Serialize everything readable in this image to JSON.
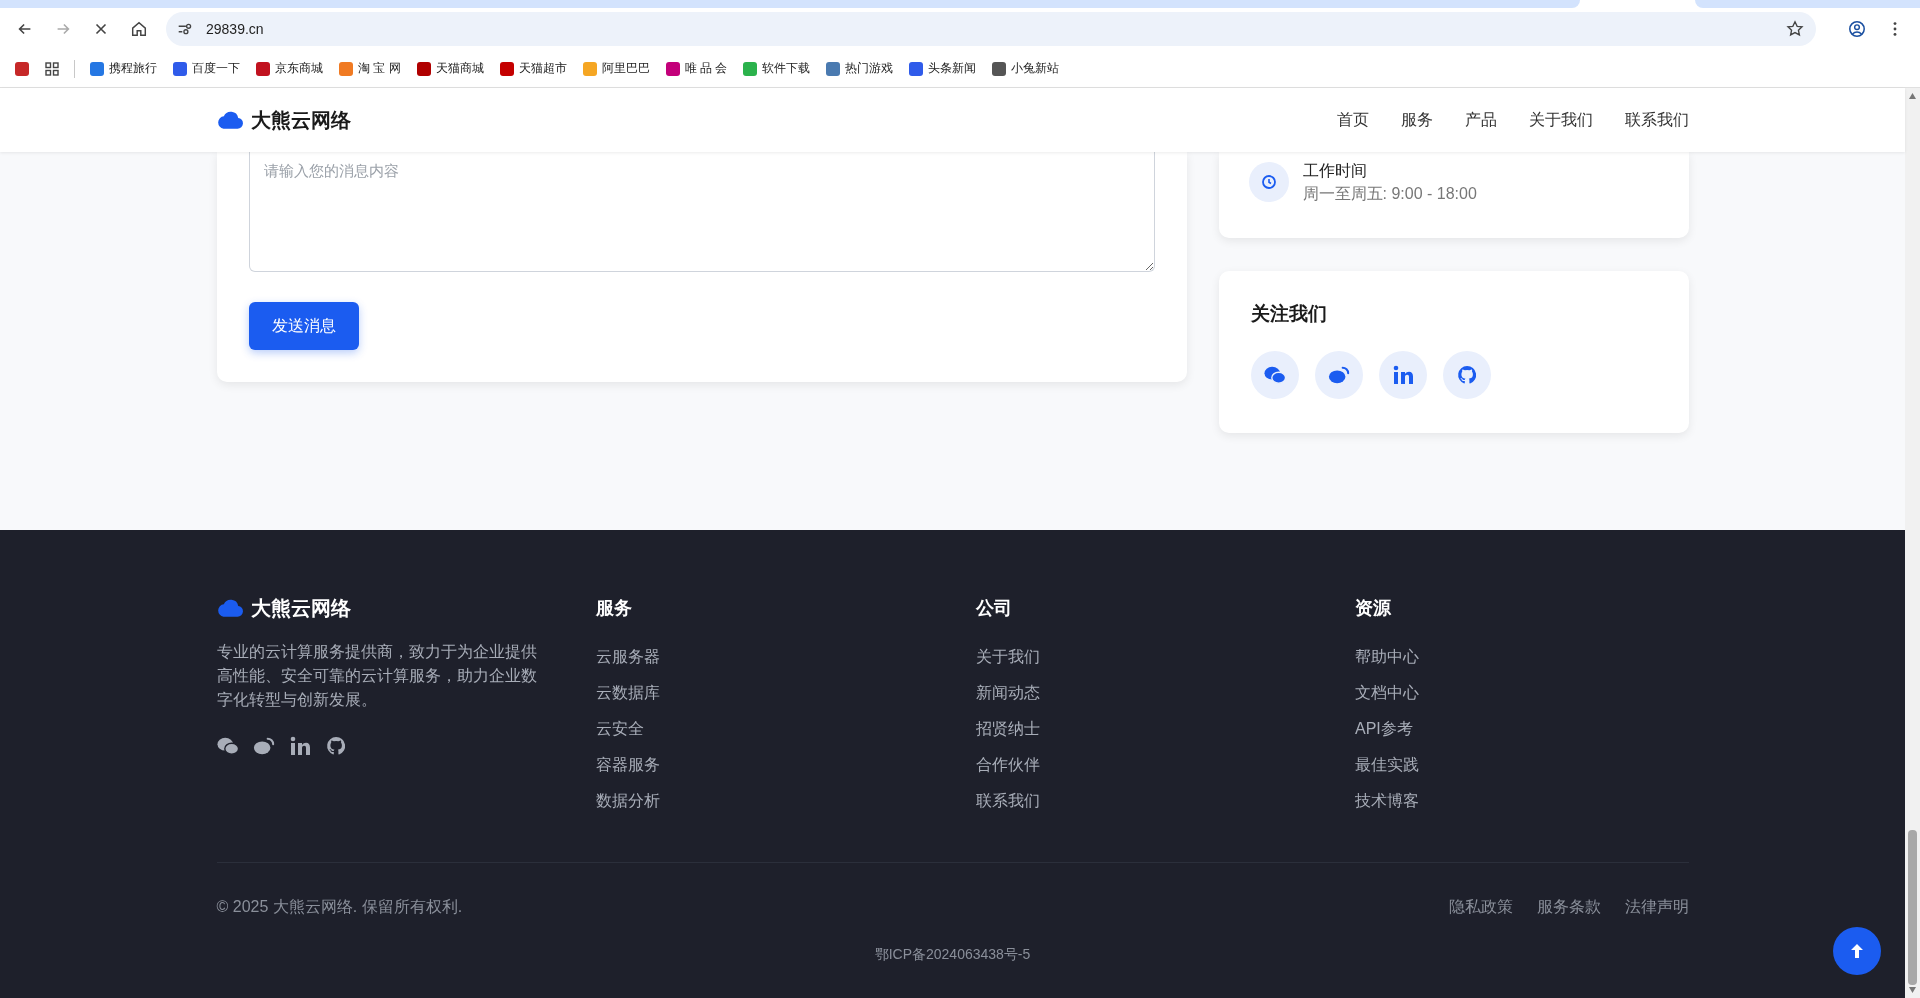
{
  "browser": {
    "url": "29839.cn",
    "bookmarks": [
      {
        "label": "携程旅行",
        "color": "#2577e3"
      },
      {
        "label": "百度一下",
        "color": "#2f5bea"
      },
      {
        "label": "京东商城",
        "color": "#c1121f"
      },
      {
        "label": "淘 宝 网",
        "color": "#f07a22"
      },
      {
        "label": "天猫商城",
        "color": "#b00000"
      },
      {
        "label": "天猫超市",
        "color": "#c40000"
      },
      {
        "label": "阿里巴巴",
        "color": "#f5a623"
      },
      {
        "label": "唯 品 会",
        "color": "#c3007a"
      },
      {
        "label": "软件下载",
        "color": "#2bb24c"
      },
      {
        "label": "热门游戏",
        "color": "#4a7ab0"
      },
      {
        "label": "头条新闻",
        "color": "#2f5bea"
      },
      {
        "label": "小兔新站",
        "color": "#555555"
      }
    ]
  },
  "navbar": {
    "logo": "大熊云网络",
    "links": [
      "首页",
      "服务",
      "产品",
      "关于我们",
      "联系我们"
    ]
  },
  "contact_form": {
    "message_placeholder": "请输入您的消息内容",
    "submit": "发送消息"
  },
  "hours_card": {
    "title": "工作时间",
    "value": "周一至周五: 9:00 - 18:00"
  },
  "follow_card": {
    "title": "关注我们"
  },
  "footer": {
    "logo": "大熊云网络",
    "description": "专业的云计算服务提供商，致力于为企业提供高性能、安全可靠的云计算服务，助力企业数字化转型与创新发展。",
    "columns": [
      {
        "title": "服务",
        "links": [
          "云服务器",
          "云数据库",
          "云安全",
          "容器服务",
          "数据分析"
        ]
      },
      {
        "title": "公司",
        "links": [
          "关于我们",
          "新闻动态",
          "招贤纳士",
          "合作伙伴",
          "联系我们"
        ]
      },
      {
        "title": "资源",
        "links": [
          "帮助中心",
          "文档中心",
          "API参考",
          "最佳实践",
          "技术博客"
        ]
      }
    ],
    "copyright": "© 2025 大熊云网络. 保留所有权利.",
    "legal_links": [
      "隐私政策",
      "服务条款",
      "法律声明"
    ],
    "icp": "鄂ICP备2024063438号-5"
  }
}
